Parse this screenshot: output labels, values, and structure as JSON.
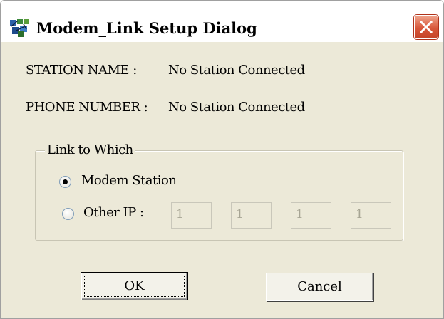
{
  "window": {
    "title": "Modem_Link Setup Dialog",
    "icon": "app-icon",
    "close_icon": "close-icon"
  },
  "station": {
    "name_label": "STATION NAME :",
    "name_value": "No Station Connected",
    "phone_label": "PHONE NUMBER :",
    "phone_value": "No Station Connected"
  },
  "link_group": {
    "legend": "Link to Which",
    "options": [
      {
        "label": "Modem Station",
        "selected": true
      },
      {
        "label": "Other IP :",
        "selected": false
      }
    ],
    "ip_octets": [
      "1",
      "1",
      "1",
      "1"
    ]
  },
  "buttons": {
    "ok": "OK",
    "cancel": "Cancel"
  },
  "colors": {
    "dialog_bg": "#ece9d8",
    "close_button": "#d8573a",
    "disabled_text": "#a7a594"
  }
}
